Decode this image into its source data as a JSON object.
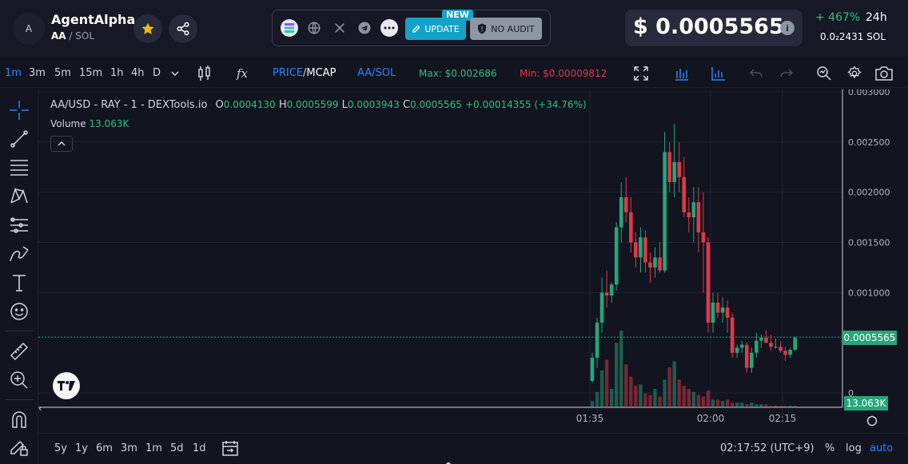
{
  "header": {
    "avatar_letter": "A",
    "token_name": "AgentAlpha",
    "token_symbol": "AA",
    "pair_quote": "/ SOL",
    "update_label": "UPDATE",
    "new_badge": "NEW",
    "no_audit_label": "NO AUDIT",
    "price": "$ 0.0005565",
    "info_glyph": "i",
    "change_24h": "+ 467%",
    "change_label": "24h",
    "sol_price": "0.0₂2431",
    "sol_label": "SOL"
  },
  "toolbar": {
    "intervals": [
      "1m",
      "3m",
      "5m",
      "15m",
      "1h",
      "4h",
      "D"
    ],
    "active_interval": "1m",
    "fx_label": "fx",
    "price_label": "PRICE",
    "mcap_label": "MCAP",
    "pair_label": "AA/SOL",
    "max_label": "Max: $0.002686",
    "min_label": "Min: $0.00009812",
    "colors": {
      "active": "#2a84ff",
      "max": "#2fbf86",
      "min": "#e0394a",
      "up": "#26a67a",
      "down": "#e0394a"
    }
  },
  "legend": {
    "symbol": "AA/USD - RAY - 1 - DEXTools.io",
    "o_label": "O",
    "o_val": "0.0004130",
    "h_label": "H",
    "h_val": "0.0005599",
    "l_label": "L",
    "l_val": "0.0003943",
    "c_label": "C",
    "c_val": "0.0005565",
    "change": "+0.00014355 (+34.76%)",
    "volume_label": "Volume",
    "volume_val": "13.063K"
  },
  "chart_data": {
    "type": "candlestick",
    "y_ticks": [
      "0.003000",
      "0.002500",
      "0.002000",
      "0.001500",
      "0.001000",
      "0"
    ],
    "y_tick_values": [
      0.003,
      0.0025,
      0.002,
      0.0015,
      0.001,
      0
    ],
    "x_ticks": [
      "01:35",
      "02:00",
      "02:15"
    ],
    "last_price_label": "0.0005565",
    "last_price": 0.0005565,
    "volume_label": "13.063K",
    "candles": [
      {
        "o": 0.00012,
        "h": 0.0004,
        "l": 0.0001,
        "c": 0.00035
      },
      {
        "o": 0.00035,
        "h": 0.00075,
        "l": 0.00025,
        "c": 0.0007
      },
      {
        "o": 0.0007,
        "h": 0.00115,
        "l": 0.0006,
        "c": 0.001
      },
      {
        "o": 0.001,
        "h": 0.00122,
        "l": 0.00085,
        "c": 0.00097
      },
      {
        "o": 0.00097,
        "h": 0.0011,
        "l": 0.0009,
        "c": 0.00108
      },
      {
        "o": 0.00108,
        "h": 0.0017,
        "l": 0.00102,
        "c": 0.00165
      },
      {
        "o": 0.00165,
        "h": 0.0021,
        "l": 0.0015,
        "c": 0.00195
      },
      {
        "o": 0.00195,
        "h": 0.00215,
        "l": 0.0017,
        "c": 0.0018
      },
      {
        "o": 0.0018,
        "h": 0.00195,
        "l": 0.0014,
        "c": 0.0015
      },
      {
        "o": 0.0015,
        "h": 0.0016,
        "l": 0.00125,
        "c": 0.00135
      },
      {
        "o": 0.00135,
        "h": 0.00165,
        "l": 0.0012,
        "c": 0.00155
      },
      {
        "o": 0.00155,
        "h": 0.00162,
        "l": 0.0012,
        "c": 0.0013
      },
      {
        "o": 0.0013,
        "h": 0.0014,
        "l": 0.0011,
        "c": 0.00125
      },
      {
        "o": 0.00125,
        "h": 0.00145,
        "l": 0.00115,
        "c": 0.00135
      },
      {
        "o": 0.00135,
        "h": 0.0015,
        "l": 0.0012,
        "c": 0.00122
      },
      {
        "o": 0.00122,
        "h": 0.0026,
        "l": 0.0012,
        "c": 0.0024
      },
      {
        "o": 0.0024,
        "h": 0.0025,
        "l": 0.002,
        "c": 0.0021
      },
      {
        "o": 0.0021,
        "h": 0.00268,
        "l": 0.00195,
        "c": 0.0023
      },
      {
        "o": 0.0023,
        "h": 0.0025,
        "l": 0.002,
        "c": 0.00215
      },
      {
        "o": 0.00215,
        "h": 0.00235,
        "l": 0.00175,
        "c": 0.0018
      },
      {
        "o": 0.0018,
        "h": 0.00195,
        "l": 0.0016,
        "c": 0.00175
      },
      {
        "o": 0.00175,
        "h": 0.00205,
        "l": 0.0015,
        "c": 0.0019
      },
      {
        "o": 0.0019,
        "h": 0.00205,
        "l": 0.0014,
        "c": 0.0016
      },
      {
        "o": 0.0016,
        "h": 0.002,
        "l": 0.001,
        "c": 0.0015
      },
      {
        "o": 0.0015,
        "h": 0.00155,
        "l": 0.0006,
        "c": 0.0007
      },
      {
        "o": 0.0007,
        "h": 0.001,
        "l": 0.0006,
        "c": 0.0009
      },
      {
        "o": 0.0009,
        "h": 0.001,
        "l": 0.00075,
        "c": 0.0008
      },
      {
        "o": 0.0008,
        "h": 0.00095,
        "l": 0.0007,
        "c": 0.00085
      },
      {
        "o": 0.00085,
        "h": 0.00092,
        "l": 0.0006,
        "c": 0.00075
      },
      {
        "o": 0.00075,
        "h": 0.0008,
        "l": 0.00035,
        "c": 0.0004
      },
      {
        "o": 0.0004,
        "h": 0.00048,
        "l": 0.00035,
        "c": 0.00045
      },
      {
        "o": 0.00045,
        "h": 0.00052,
        "l": 0.0004,
        "c": 0.00048
      },
      {
        "o": 0.00048,
        "h": 0.0005,
        "l": 0.0002,
        "c": 0.00025
      },
      {
        "o": 0.00025,
        "h": 0.00045,
        "l": 0.0002,
        "c": 0.0004
      },
      {
        "o": 0.0004,
        "h": 0.0006,
        "l": 0.00035,
        "c": 0.00052
      },
      {
        "o": 0.00052,
        "h": 0.00058,
        "l": 0.00045,
        "c": 0.00055
      },
      {
        "o": 0.00055,
        "h": 0.00062,
        "l": 0.0005,
        "c": 0.0005
      },
      {
        "o": 0.0005,
        "h": 0.00058,
        "l": 0.00042,
        "c": 0.00046
      },
      {
        "o": 0.00046,
        "h": 0.00054,
        "l": 0.00044,
        "c": 0.00046
      },
      {
        "o": 0.00046,
        "h": 0.00052,
        "l": 0.0004,
        "c": 0.00042
      },
      {
        "o": 0.00042,
        "h": 0.00046,
        "l": 0.00032,
        "c": 0.00038
      },
      {
        "o": 0.00038,
        "h": 0.00045,
        "l": 0.00035,
        "c": 0.00043
      },
      {
        "o": 0.00043,
        "h": 0.00056,
        "l": 0.00042,
        "c": 0.00055
      }
    ],
    "volumes": [
      4,
      10,
      24,
      31,
      12,
      42,
      50,
      28,
      20,
      14,
      15,
      9,
      8,
      12,
      7,
      18,
      26,
      30,
      18,
      14,
      12,
      10,
      8,
      7,
      11,
      5,
      5,
      4,
      5,
      3,
      3,
      3,
      2,
      3,
      2,
      2,
      2,
      1,
      1,
      1,
      1,
      1,
      1
    ]
  },
  "bottom": {
    "ranges": [
      "5y",
      "1y",
      "6m",
      "3m",
      "1m",
      "5d",
      "1d"
    ],
    "time": "02:17:52 (UTC+9)",
    "percent": "%",
    "log": "log",
    "auto": "auto"
  }
}
